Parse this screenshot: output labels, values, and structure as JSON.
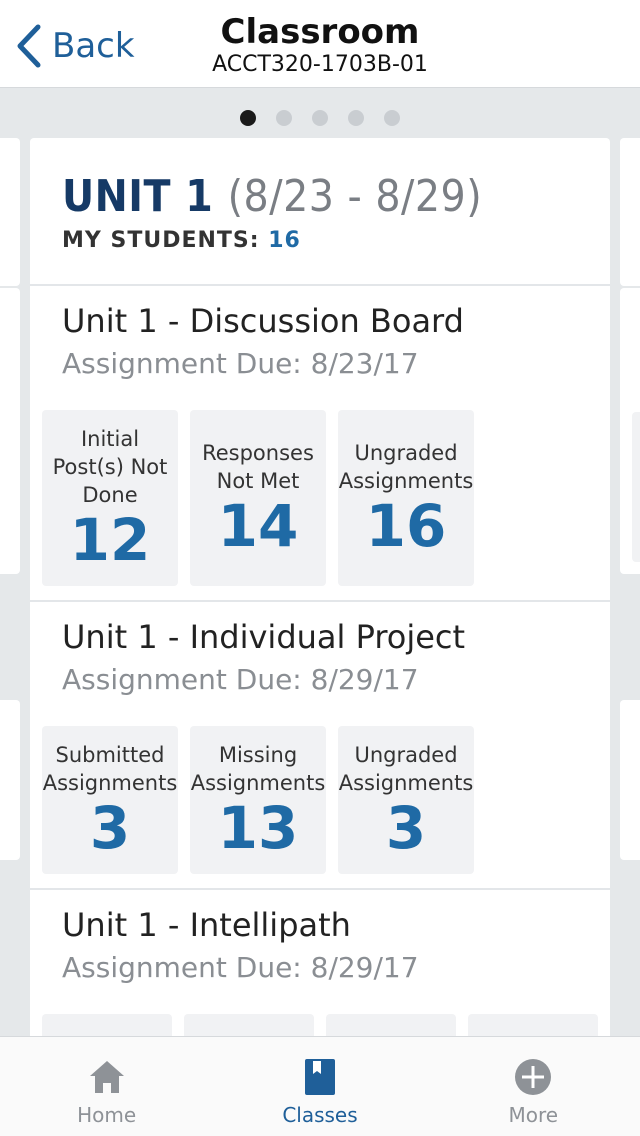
{
  "header": {
    "back_label": "Back",
    "title": "Classroom",
    "subtitle": "ACCT320-1703B-01"
  },
  "pager": {
    "pages": 5,
    "active_index": 0
  },
  "unit": {
    "title": "UNIT 1",
    "dates": "(8/23 - 8/29)",
    "students_label": "MY STUDENTS:",
    "students_count": "16"
  },
  "assignments": [
    {
      "name": "Unit 1 - Discussion Board",
      "due": "Assignment Due: 8/23/17",
      "stats": [
        {
          "label": "Initial Post(s) Not Done",
          "value": "12"
        },
        {
          "label": "Responses Not Met",
          "value": "14"
        },
        {
          "label": "Ungraded Assignments",
          "value": "16"
        }
      ]
    },
    {
      "name": "Unit 1 - Individual Project",
      "due": "Assignment Due: 8/29/17",
      "stats": [
        {
          "label": "Submitted Assignments",
          "value": "3"
        },
        {
          "label": "Missing Assignments",
          "value": "13"
        },
        {
          "label": "Ungraded Assignments",
          "value": "3"
        }
      ]
    },
    {
      "name": "Unit 1 - Intellipath",
      "due": "Assignment Due: 8/29/17"
    }
  ],
  "tabs": [
    {
      "label": "Home",
      "icon": "home-icon",
      "active": false
    },
    {
      "label": "Classes",
      "icon": "book-icon",
      "active": true
    },
    {
      "label": "More",
      "icon": "plus-circle-icon",
      "active": false
    }
  ],
  "colors": {
    "accent": "#1f5f99",
    "value_blue": "#1f6aa5",
    "unit_title": "#163a66",
    "background": "#e5e8ea"
  }
}
